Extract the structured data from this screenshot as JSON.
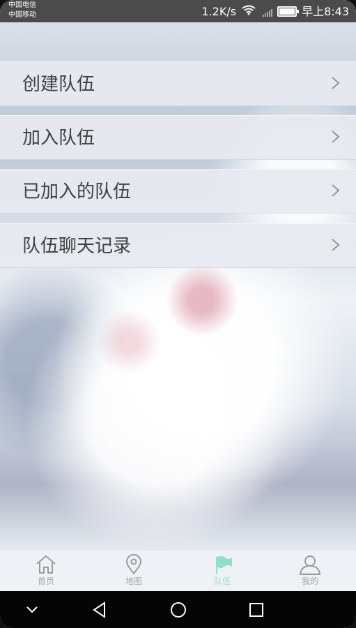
{
  "status_bar": {
    "carrier_1": "中国电信",
    "carrier_2": "中国移动",
    "network_speed": "1.2K/s",
    "time": "早上8:43",
    "icons": [
      "wifi-icon",
      "signal-icon",
      "battery-icon"
    ]
  },
  "menu": {
    "items": [
      {
        "label": "创建队伍",
        "icon": "chevron-right-icon"
      },
      {
        "label": "加入队伍",
        "icon": "chevron-right-icon"
      },
      {
        "label": "已加入的队伍",
        "icon": "chevron-right-icon"
      },
      {
        "label": "队伍聊天记录",
        "icon": "chevron-right-icon"
      }
    ]
  },
  "tabbar": {
    "items": [
      {
        "label": "首页",
        "icon": "home-icon",
        "active": false
      },
      {
        "label": "地图",
        "icon": "map-pin-icon",
        "active": false
      },
      {
        "label": "队伍",
        "icon": "flag-icon",
        "active": true
      },
      {
        "label": "我的",
        "icon": "user-icon",
        "active": false
      }
    ],
    "active_color": "#8fe0c9"
  },
  "system_nav": {
    "icons": [
      "chevron-down-icon",
      "back-icon",
      "home-circle-icon",
      "recents-square-icon"
    ]
  }
}
